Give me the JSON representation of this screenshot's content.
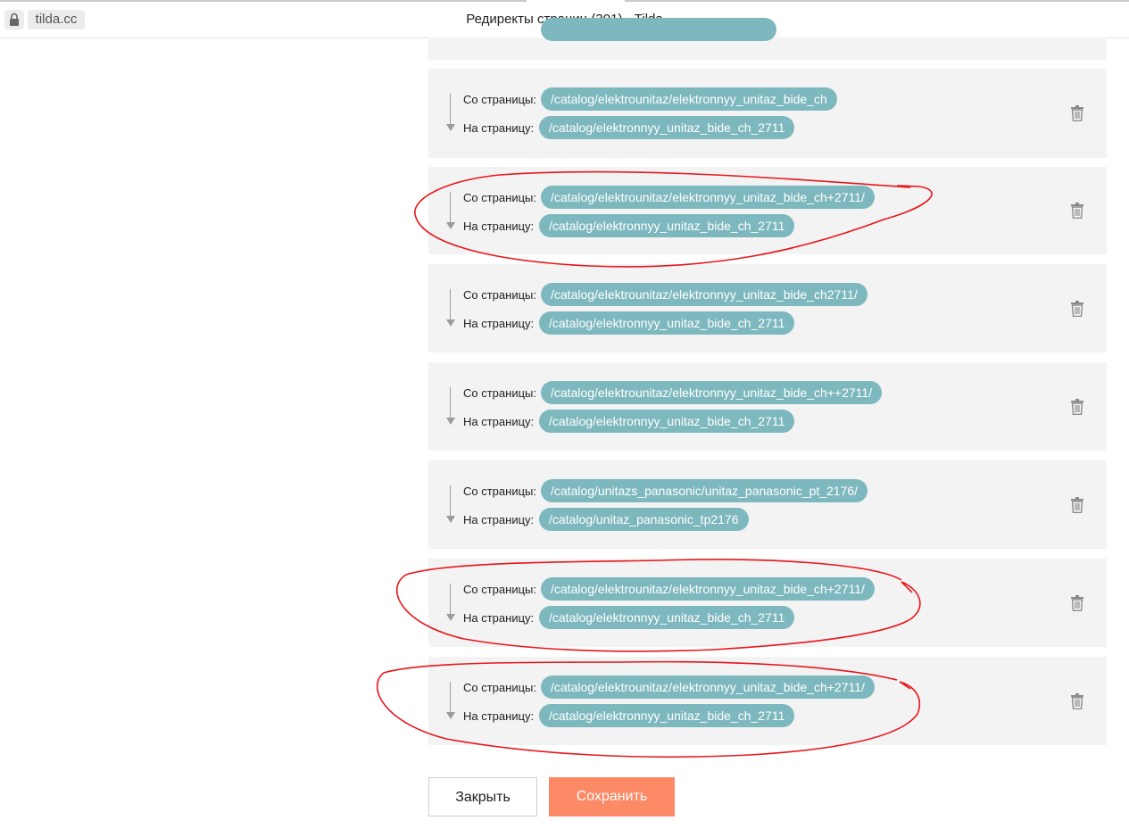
{
  "browser": {
    "url": "tilda.cc",
    "title": "Редиректы страниц (301) - Tilda"
  },
  "labels": {
    "from": "Со страницы:",
    "to": "На страницу:"
  },
  "redirects": [
    {
      "from": "/catalog/elektrounitaz/elektronnyy_unitaz_bide_ch",
      "to": "/catalog/elektronnyy_unitaz_bide_ch_2711"
    },
    {
      "from": "/catalog/elektrounitaz/elektronnyy_unitaz_bide_ch+2711/",
      "to": "/catalog/elektronnyy_unitaz_bide_ch_2711"
    },
    {
      "from": "/catalog/elektrounitaz/elektronnyy_unitaz_bide_ch2711/",
      "to": "/catalog/elektronnyy_unitaz_bide_ch_2711"
    },
    {
      "from": "/catalog/elektrounitaz/elektronnyy_unitaz_bide_ch++2711/",
      "to": "/catalog/elektronnyy_unitaz_bide_ch_2711"
    },
    {
      "from": "/catalog/unitazs_panasonic/unitaz_panasonic_pt_2176/",
      "to": "/catalog/unitaz_panasonic_tp2176"
    },
    {
      "from": "/catalog/elektrounitaz/elektronnyy_unitaz_bide_ch+2711/",
      "to": "/catalog/elektronnyy_unitaz_bide_ch_2711"
    },
    {
      "from": "/catalog/elektrounitaz/elektronnyy_unitaz_bide_ch+2711/",
      "to": "/catalog/elektronnyy_unitaz_bide_ch_2711"
    }
  ],
  "buttons": {
    "close": "Закрыть",
    "save": "Сохранить"
  },
  "colors": {
    "pill": "#7eb8bf",
    "row_bg": "#f3f3f3",
    "save_button": "#fd8a66",
    "annotation": "#e8161b"
  },
  "icons": {
    "lock": "lock-icon",
    "trash": "trash-icon",
    "arrow": "arrow-down-icon"
  }
}
